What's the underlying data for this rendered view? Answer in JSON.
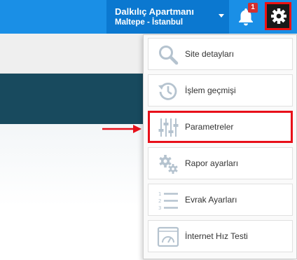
{
  "header": {
    "site_name": "Dalkılıç Apartmanı",
    "site_location": "Maltepe - İstanbul",
    "notification_count": "1"
  },
  "menu": {
    "items": [
      {
        "label": "Site detayları",
        "icon": "search-icon"
      },
      {
        "label": "İşlem geçmişi",
        "icon": "history-clock-icon"
      },
      {
        "label": "Parametreler",
        "icon": "sliders-icon",
        "highlighted": true
      },
      {
        "label": "Rapor ayarları",
        "icon": "gears-icon"
      },
      {
        "label": "Evrak Ayarları",
        "icon": "numbered-list-icon"
      },
      {
        "label": "İnternet Hız Testi",
        "icon": "speedometer-icon"
      }
    ]
  },
  "colors": {
    "topbar": "#1a8fe6",
    "site_block": "#0b78d0",
    "highlight_border": "#e8101a",
    "dark_band": "#184a5e"
  }
}
